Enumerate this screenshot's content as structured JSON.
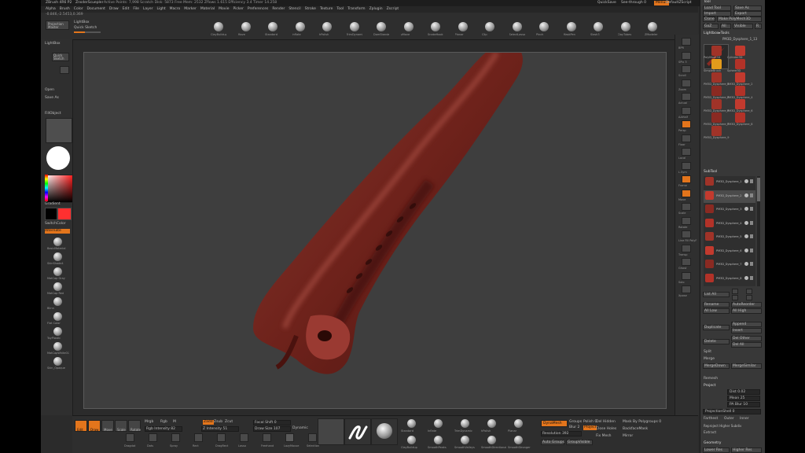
{
  "title_bar": {
    "app_name": "ZBrush 4R6 P2",
    "document": "ZnsderScuepler",
    "stats": "Active Points: 7,998  Scratch Disk: 5873  Free Mem: 2532  Zflows 1.615  Efficiency 3.4  Timer 14.258",
    "quicksave": "QuickSave",
    "seethrough": "See-through 0",
    "menus_label": "Menus",
    "script": "DefaultZScript"
  },
  "menu_items": [
    "Alpha",
    "Brush",
    "Color",
    "Document",
    "Draw",
    "Edit",
    "File",
    "Layer",
    "Light",
    "Macro",
    "Marker",
    "Material",
    "Movie",
    "Picker",
    "Preferences",
    "Render",
    "Stencil",
    "Stroke",
    "Texture",
    "Tool",
    "Transform",
    "Zplugin",
    "Zscript"
  ],
  "coords": "-0.846,-2.5453,0.369",
  "top_shelf": {
    "projection_master": "Projection Master",
    "lightbox": "LightBox",
    "quick_sketch": "Quick Sketch",
    "brushes": [
      "ClayBuildup",
      "Move",
      "Standard",
      "Inflate",
      "hPolish",
      "TrimDynamic",
      "DamStandard",
      "pMove",
      "SnakeHook",
      "Planar",
      "Clip",
      "SelectLasso",
      "Pinch",
      "MaskPen",
      "Slash3",
      "ClayTubes",
      "ZModeler"
    ]
  },
  "left_shelf": {
    "lightbox": "LightBox",
    "quick_sketch": "Quick Sketch",
    "open": "Open",
    "save_as": "Save As",
    "fill_object": "FillObject",
    "gradient": "Gradient",
    "switch_color": "SwitchColor",
    "alternate": "Alternate",
    "materials": [
      "BasicMaterial",
      "SkinShade4",
      "MatCap Gray",
      "MatCap Red",
      "Blinn",
      "Flat Color",
      "ToyPlastic",
      "MatCapWhite01",
      "Skin_Opaque"
    ],
    "swatch_color": "#ff3030"
  },
  "right_shelf": {
    "items": [
      "BPR",
      "SPix 3",
      "Scroll",
      "Zoom",
      "Actual",
      "AAHalf",
      "Persp",
      "Floor",
      "Local",
      "L.Sym",
      "Frame",
      "Move",
      "Scale",
      "Rotate",
      "Line Fill PolyF",
      "Transp",
      "Ghost",
      "Solo",
      "Xpose"
    ]
  },
  "tool_palette": {
    "header": "Tool",
    "load_tool": "Load Tool",
    "save_as": "Save As",
    "import": "Import",
    "export": "Export",
    "clone": "Clone",
    "make_polymesh": "Make PolyMesh3D",
    "goz": "GoZ",
    "all": "All",
    "visible": "Visible",
    "r": "R",
    "lightbox_tools": "Lightbox▸Tools",
    "current_tool": "PM3D_Dysphere_1_13",
    "tools": [
      "PolyMesh3D",
      "Cylinder3D",
      "SimpleBrush",
      "Sphere3D",
      "PM3D_Dysphere_1",
      "PM3D_Dysphere_2",
      "PM3D_Dysphere_3",
      "PM3D_Dysphere_4",
      "PM3D_Dysphere_5",
      "PM3D_Dysphere_6",
      "PM3D_Dysphere_7",
      "PM3D_Dysphere_8",
      "PM3D_Dysphere_9"
    ],
    "subtool_header": "SubTool",
    "subtools": [
      "PM3D_Dysphere_1",
      "PM3D_Dysphere_2",
      "PM3D_Dysphere_3",
      "PM3D_Dysphere_4",
      "PM3D_Dysphere_5",
      "PM3D_Dysphere_6",
      "PM3D_Dysphere_7",
      "PM3D_Dysphere_8"
    ],
    "list_all": "List All",
    "rename": "Rename",
    "autoreorder": "AutoReorder",
    "all_low": "All Low",
    "all_high": "All High",
    "duplicate": "Duplicate",
    "append": "Append",
    "insert": "Insert",
    "delete": "Delete",
    "del_other": "Del Other",
    "del_all": "Del All",
    "split": "Split",
    "merge": "Merge",
    "merge_down": "MergeDown",
    "merge_similar": "MergeSimilar",
    "remesh": "Remesh",
    "project": "Project",
    "dist": "Dist 0.02",
    "mean": "Mean 25",
    "pa_blur": "PA Blur 10",
    "project_shell": "ProjectionShell 0",
    "farthest": "Farthest",
    "outer": "Outer",
    "inner": "Inner",
    "reproject": "Reproject Higher Subdiv",
    "extract": "Extract",
    "geometry": "Geometry",
    "lower_res": "Lower Res",
    "higher_res": "Higher Res"
  },
  "bottom_shelf": {
    "edit": "Edit",
    "draw": "Draw",
    "move": "Move",
    "scale": "Scale",
    "rotate": "Rotate",
    "mrgb": "Mrgb",
    "rgb": "Rgb",
    "m": "M",
    "zadd": "Zadd",
    "zsub": "Zsub",
    "zcut": "Zcut",
    "rgb_intensity": "Rgb Intensity 82",
    "z_intensity": "Z Intensity 51",
    "focal_shift": "Focal Shift 0",
    "draw_size": "Draw Size 107",
    "dynamic": "Dynamic",
    "stroke_tools": [
      "Dragdot",
      "Dots",
      "Spray",
      "Rect",
      "DragRect",
      "Lasso",
      "Freehand",
      "LazyMouse",
      "Selection"
    ],
    "brush_buttons": [
      "Standard",
      "Inflate",
      "TrimDynamic",
      "hPolish",
      "Planar",
      "ClayBuildup",
      "SmoothPeaks",
      "SmoothValleys",
      "SmoothDirectional",
      "SmoothStronger"
    ],
    "dynamesh": "DynaMesh",
    "groups": "Groups",
    "polish": "Polish 0",
    "blur": "Blur 2",
    "project": "Project",
    "resolution": "Resolution 392",
    "del_hidden": "Del Hidden",
    "close_holes": "Close Holes",
    "fix_mesh": "Fix Mesh",
    "mask_by_polygroups": "Mask By Polygroups 0",
    "backface_mask": "BackfaceMask",
    "mirror": "Mirror",
    "auto_groups": "Auto Groups",
    "group_visible": "GroupVisible"
  },
  "colors": {
    "accent": "#e3751c",
    "canvas_bg": "#3e3e3e",
    "model": "#7a2a22"
  }
}
